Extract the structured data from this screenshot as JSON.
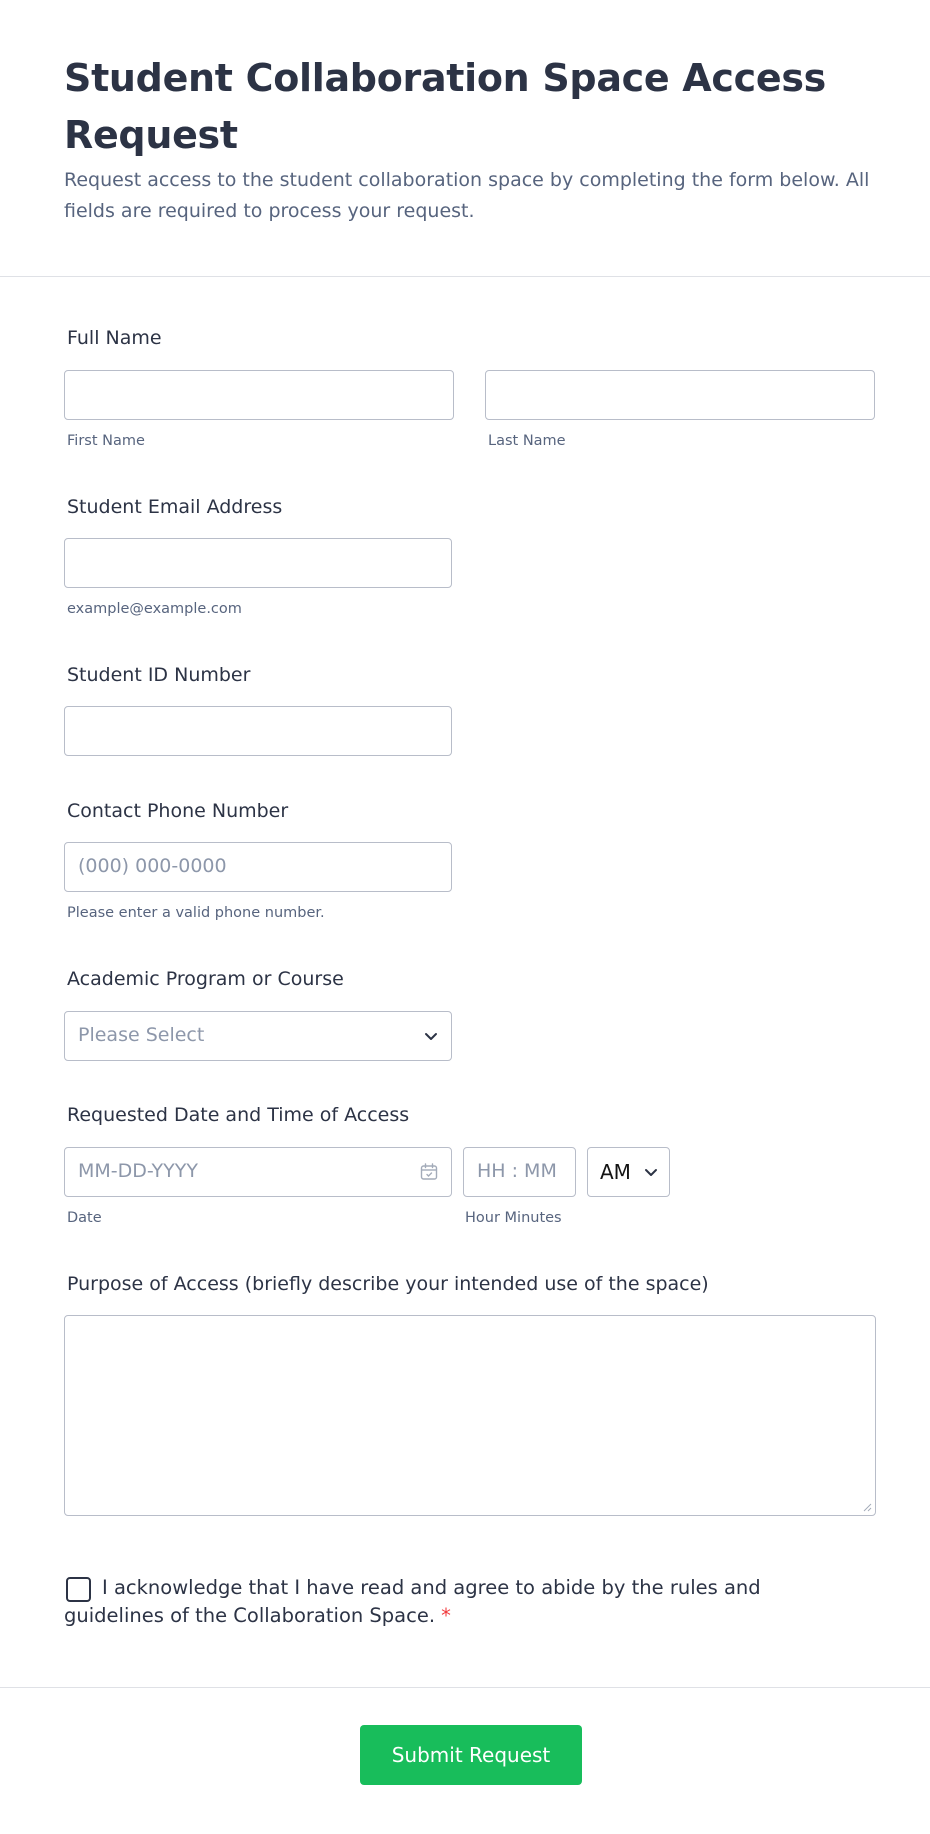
{
  "form": {
    "title": "Student Collaboration Space Access Request",
    "subtitle": "Request access to the student collaboration space by completing the form below. All fields are required to process your request."
  },
  "full_name": {
    "label": "Full Name",
    "first_sublabel": "First Name",
    "last_sublabel": "Last Name",
    "first_value": "",
    "last_value": ""
  },
  "email": {
    "label": "Student Email Address",
    "sublabel": "example@example.com",
    "value": ""
  },
  "student_id": {
    "label": "Student ID Number",
    "value": ""
  },
  "phone": {
    "label": "Contact Phone Number",
    "placeholder": "(000) 000-0000",
    "sublabel": "Please enter a valid phone number."
  },
  "program": {
    "label": "Academic Program or Course",
    "selected": "Please Select",
    "icon": "chevron-down-icon"
  },
  "datetime": {
    "label": "Requested Date and Time of Access",
    "date_placeholder": "MM-DD-YYYY",
    "date_sublabel": "Date",
    "time_placeholder": "HH : MM",
    "time_sublabel": "Hour Minutes",
    "ampm": "AM",
    "icons": [
      "calendar-icon",
      "chevron-down-icon"
    ]
  },
  "purpose": {
    "label": "Purpose of Access (briefly describe your intended use of the space)",
    "value": ""
  },
  "acknowledge": {
    "text": "I acknowledge that I have read and agree to abide by the rules and guidelines of the Collaboration Space.",
    "required_mark": "*",
    "checked": false
  },
  "submit": {
    "label": "Submit Request"
  },
  "colors": {
    "submit_bg": "#18bd5b",
    "required": "#f23a3c",
    "text": "#2c3345",
    "muted": "#57647e",
    "border": "#b8bdc9"
  }
}
